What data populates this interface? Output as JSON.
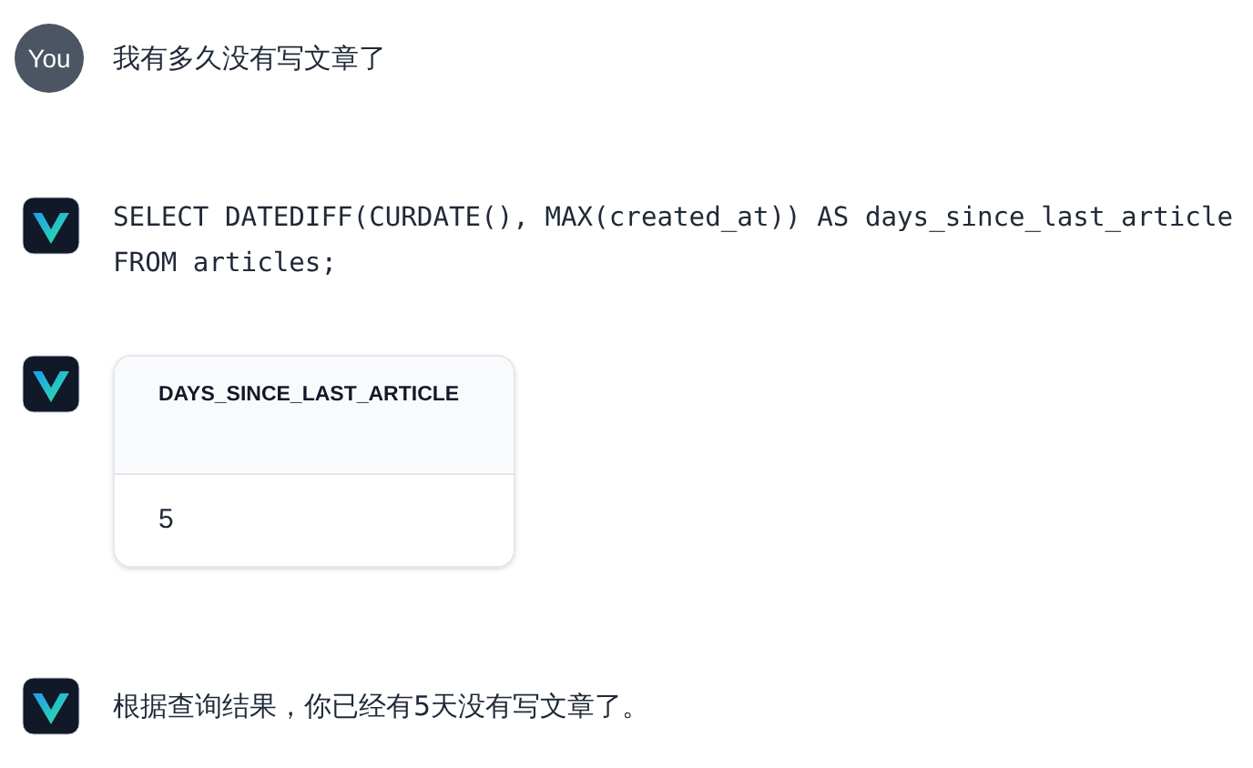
{
  "messages": [
    {
      "kind": "user",
      "avatar": "You",
      "text": "我有多久没有写文章了"
    },
    {
      "kind": "sql",
      "lines": [
        "SELECT DATEDIFF(CURDATE(), MAX(created_at)) AS days_since_last_article",
        "FROM articles;"
      ]
    },
    {
      "kind": "table",
      "columns": [
        "DAYS_SINCE_LAST_ARTICLE"
      ],
      "rows": [
        [
          "5"
        ]
      ]
    },
    {
      "kind": "text",
      "text": "根据查询结果，你已经有5天没有写文章了。"
    }
  ]
}
